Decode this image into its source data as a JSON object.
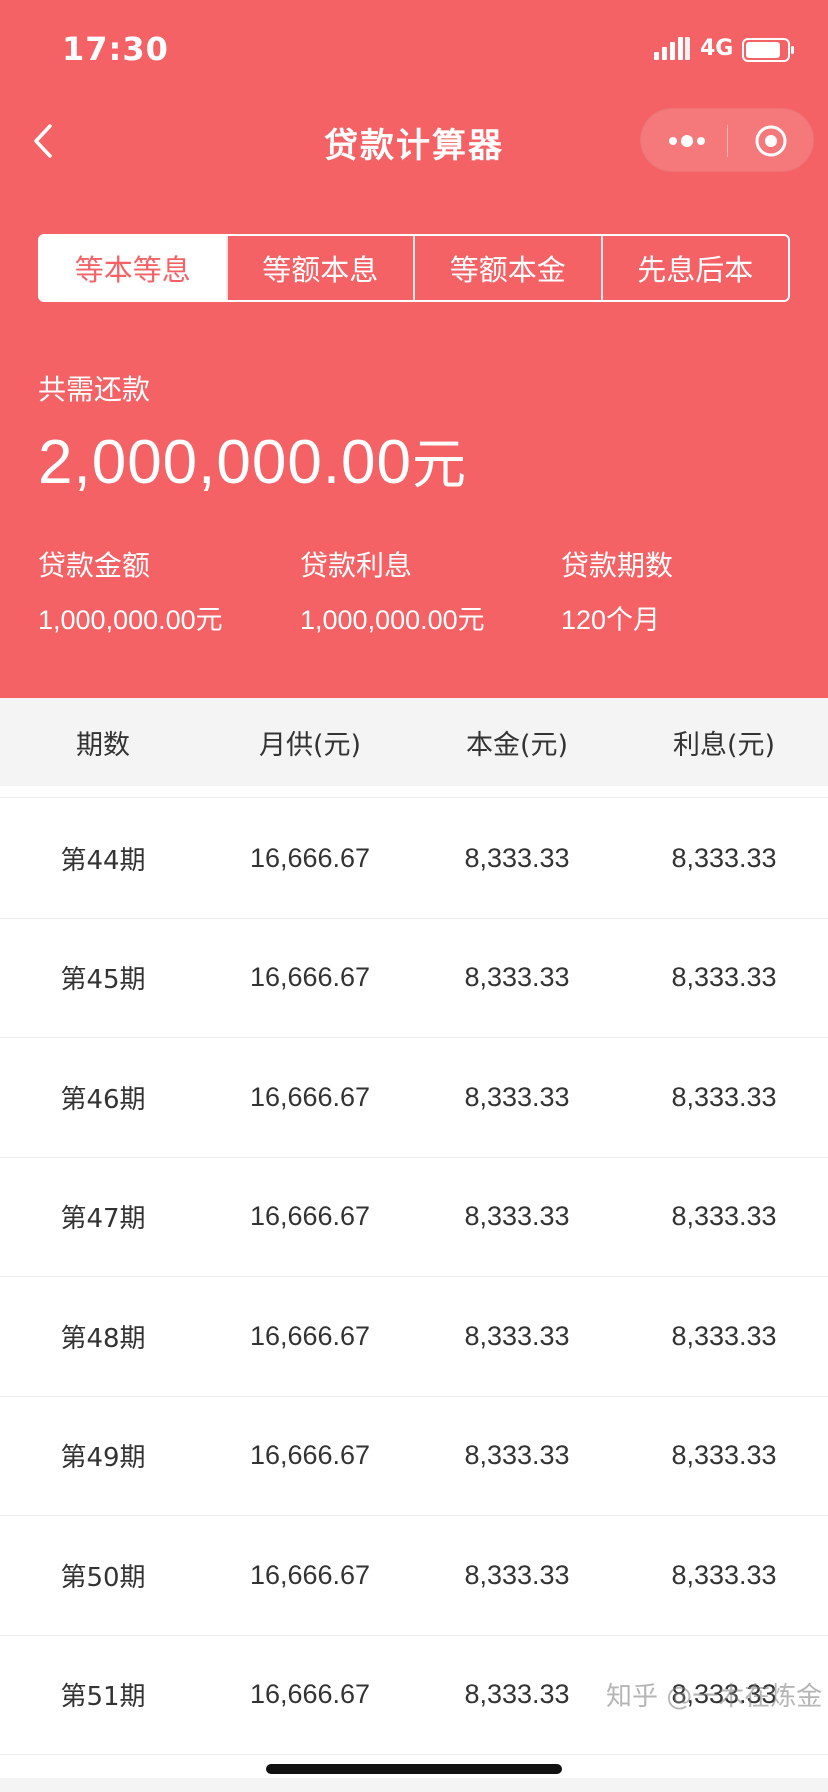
{
  "status_bar": {
    "time": "17:30",
    "network": "4G",
    "signal_icon": "signal-bars-icon",
    "battery_icon": "battery-icon"
  },
  "nav": {
    "title": "贷款计算器",
    "back_icon": "chevron-left-icon",
    "more_icon": "more-dots-icon",
    "close_icon": "mini-program-close-icon"
  },
  "tabs": [
    {
      "label": "等本等息",
      "active": true
    },
    {
      "label": "等额本息",
      "active": false
    },
    {
      "label": "等额本金",
      "active": false
    },
    {
      "label": "先息后本",
      "active": false
    }
  ],
  "summary": {
    "total_label": "共需还款",
    "total_number": "2,000,000.00",
    "total_unit": "元",
    "loan_amount_label": "贷款金额",
    "loan_amount_number": "1,000,000.00",
    "loan_amount_unit": "元",
    "interest_label": "贷款利息",
    "interest_number": "1,000,000.00",
    "interest_unit": "元",
    "term_label": "贷款期数",
    "term_value": "120个月"
  },
  "table": {
    "headers": [
      "期数",
      "月供(元)",
      "本金(元)",
      "利息(元)"
    ],
    "rows": [
      [
        "第44期",
        "16,666.67",
        "8,333.33",
        "8,333.33"
      ],
      [
        "第45期",
        "16,666.67",
        "8,333.33",
        "8,333.33"
      ],
      [
        "第46期",
        "16,666.67",
        "8,333.33",
        "8,333.33"
      ],
      [
        "第47期",
        "16,666.67",
        "8,333.33",
        "8,333.33"
      ],
      [
        "第48期",
        "16,666.67",
        "8,333.33",
        "8,333.33"
      ],
      [
        "第49期",
        "16,666.67",
        "8,333.33",
        "8,333.33"
      ],
      [
        "第50期",
        "16,666.67",
        "8,333.33",
        "8,333.33"
      ],
      [
        "第51期",
        "16,666.67",
        "8,333.33",
        "8,333.33"
      ]
    ]
  },
  "watermark": "知乎 @一木在炼金",
  "colors": {
    "accent": "#f46266",
    "header_bg": "#f4f4f4",
    "text": "#333333"
  }
}
